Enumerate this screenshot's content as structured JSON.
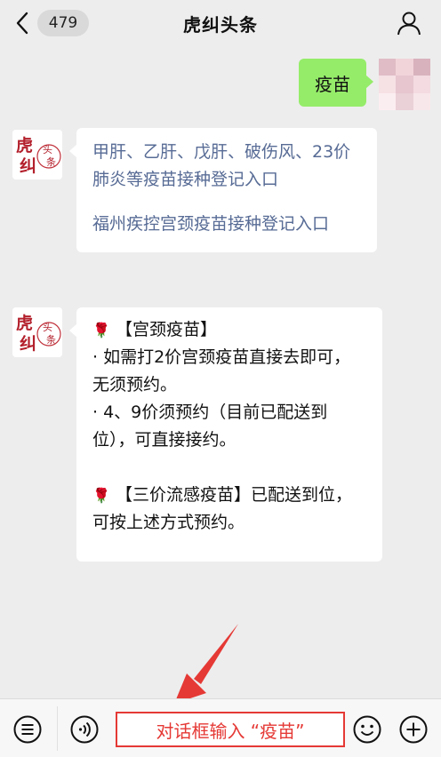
{
  "header": {
    "back_count": "479",
    "title": "虎纠头条"
  },
  "user_message": "疫苗",
  "bot": {
    "avatar_char_1": "虎",
    "avatar_char_2": "纠",
    "avatar_char_3": "头",
    "avatar_char_4": "条"
  },
  "message1": {
    "link1": "甲肝、乙肝、戊肝、破伤风、23价肺炎等疫苗接种登记入口",
    "link2": "福州疾控宫颈疫苗接种登记入口"
  },
  "message2": {
    "rose_icon": "🌹",
    "line1": "【宫颈疫苗】",
    "line2": "· 如需打2价宫颈疫苗直接去即可，无须预约。",
    "line3": "· 4、9价须预约（目前已配送到位），可直接接约。",
    "line4": "【三价流感疫苗】已配送到位，可按上述方式预约。"
  },
  "input": {
    "text": "对话框输入 “疫苗”"
  },
  "colors": {
    "accent_red": "#e53935",
    "self_bubble": "#95ec69",
    "link_blue": "#576b95"
  },
  "icons": [
    "chevron-left-icon",
    "profile-icon",
    "menu-list-icon",
    "voice-icon",
    "emoji-icon",
    "plus-icon"
  ]
}
